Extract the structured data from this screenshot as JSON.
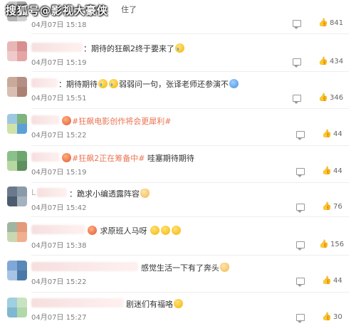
{
  "watermark": "搜狐号@影视大豪侠",
  "comments": [
    {
      "id": "c0",
      "suffix": "住了",
      "date": "04月07日 15:18",
      "likes": "841",
      "avatar_colors": [
        "#c8c8c8",
        "#a9a9a9",
        "#b5b5b5",
        "#d0d0d0"
      ]
    },
    {
      "id": "c1",
      "separator": "：",
      "text": "期待的狂飙2终于要来了",
      "date": "04月07日 15:19",
      "likes": "434",
      "avatar_colors": [
        "#e9b6b6",
        "#d98f8f",
        "#f0caca",
        "#e4a5a5"
      ]
    },
    {
      "id": "c2",
      "separator": "：",
      "text_a": "期待期待",
      "text_b": "弱弱问一句，张译老师还参演不",
      "date": "04月07日 15:51",
      "likes": "346",
      "avatar_colors": [
        "#c9a99a",
        "#b58f84",
        "#d8bfb2",
        "#a98274"
      ]
    },
    {
      "id": "c3",
      "hashtag": "#狂飙电影创作将会更犀利#",
      "date": "04月07日 15:22",
      "likes": "44",
      "avatar_colors": [
        "#9ec8e0",
        "#7fb37f",
        "#cfe3a8",
        "#5ca0d8"
      ]
    },
    {
      "id": "c4",
      "hashtag": "#狂飙2正在筹备中#",
      "text": "哇塞期待期待",
      "date": "04月07日 15:19",
      "likes": "44",
      "avatar_colors": [
        "#8bc08b",
        "#6fa56f",
        "#b7d8a0",
        "#5e8f5e"
      ]
    },
    {
      "id": "c5",
      "prefix": "L",
      "separator": "：",
      "text": "跪求小编透露阵容",
      "date": "04月07日 15:42",
      "likes": "76",
      "avatar_colors": [
        "#6a7a8c",
        "#8b9aa8",
        "#4c5c6e",
        "#a4b2bd"
      ]
    },
    {
      "id": "c6",
      "text": "求原班人马呀",
      "date": "04月07日 15:38",
      "likes": "156",
      "avatar_colors": [
        "#9fb59f",
        "#e39a7a",
        "#c9d8b0",
        "#f0b090"
      ]
    },
    {
      "id": "c7",
      "text": "感觉生活一下有了奔头",
      "date": "04月07日 15:22",
      "likes": "44",
      "avatar_colors": [
        "#7fa8d8",
        "#5b86b8",
        "#a8c4e4",
        "#4a78a8"
      ]
    },
    {
      "id": "c8",
      "text": "剧迷们有福咯",
      "date": "04月07日 15:27",
      "likes": "30",
      "avatar_colors": [
        "#9fcfe0",
        "#c8e3c0",
        "#7fb8d0",
        "#b0d8a8"
      ]
    }
  ]
}
